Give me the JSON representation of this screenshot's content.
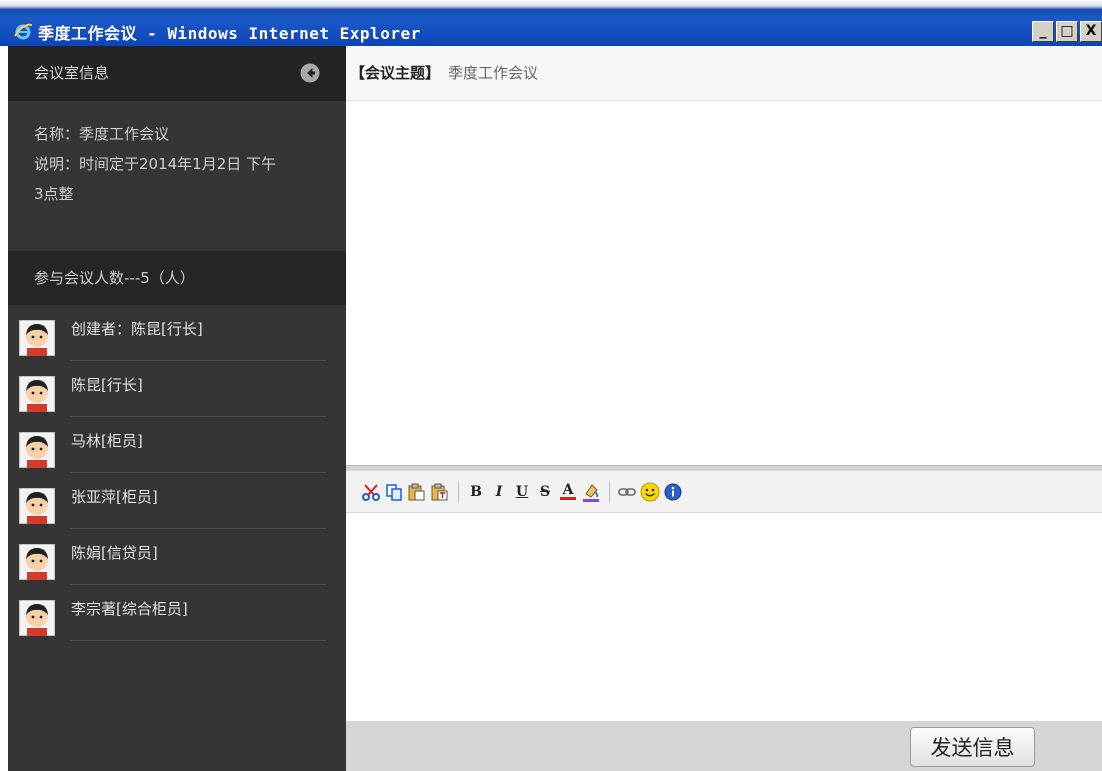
{
  "window": {
    "title": "季度工作会议 - Windows Internet Explorer",
    "buttons": {
      "minimize": "_",
      "maximize": "□",
      "close": "X"
    }
  },
  "sidebar": {
    "header_title": "会议室信息",
    "room": {
      "name_line": "名称：季度工作会议",
      "desc_line1": "说明：时间定于2014年1月2日 下午",
      "desc_line2": "3点整"
    },
    "members_header": "参与会议人数---5（人）",
    "members": [
      {
        "name": "创建者：陈昆[行长]"
      },
      {
        "name": "陈昆[行长]"
      },
      {
        "name": "马林[柜员]"
      },
      {
        "name": "张亚萍[柜员]"
      },
      {
        "name": "陈娟[信贷员]"
      },
      {
        "name": "李宗著[综合柜员]"
      }
    ]
  },
  "topic": {
    "label": "【会议主题】",
    "value": "季度工作会议"
  },
  "toolbar": {
    "bold": "B",
    "italic": "I",
    "underline": "U",
    "strike": "S",
    "fontcolor": "A"
  },
  "actions": {
    "send_label": "发送信息"
  },
  "colors": {
    "title_bar": "#1b59c8",
    "sidebar_bg": "#353535",
    "sidebar_header": "#232323"
  }
}
